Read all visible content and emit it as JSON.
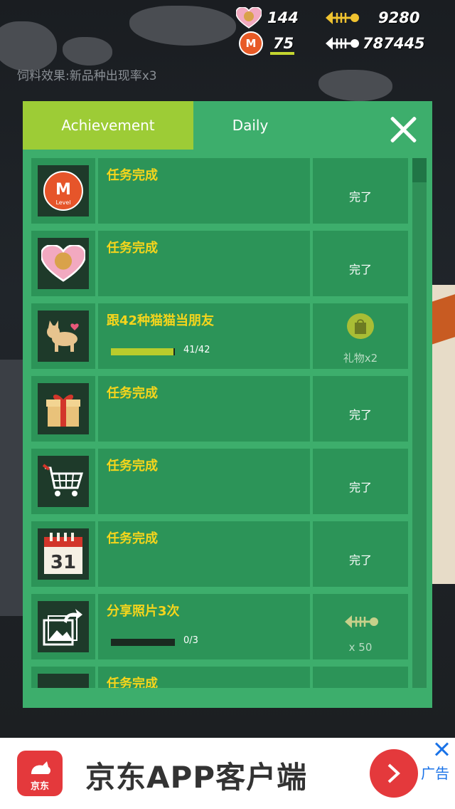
{
  "hud": {
    "hearts": "144",
    "fish_small": "9280",
    "level": "75",
    "fish_total": "787445",
    "feed_effect": "饲料效果:新品种出现率x3"
  },
  "dialog": {
    "tabs": [
      {
        "label": "Achievement",
        "active": true
      },
      {
        "label": "Daily",
        "active": false
      }
    ],
    "rows": [
      {
        "icon": "level-badge-icon",
        "title": "任务完成",
        "status": "完了"
      },
      {
        "icon": "cat-heart-icon",
        "title": "任务完成",
        "status": "完了"
      },
      {
        "icon": "cat-friend-icon",
        "title": "跟42种猫猫当朋友",
        "progress_text": "41/42",
        "progress": 0.976,
        "reward": "礼物x2",
        "reward_icon": "gift-bag-icon"
      },
      {
        "icon": "gift-box-icon",
        "title": "任务完成",
        "status": "完了"
      },
      {
        "icon": "shopping-cart-icon",
        "title": "任务完成",
        "status": "完了"
      },
      {
        "icon": "calendar-icon",
        "title": "任务完成",
        "status": "完了",
        "calendar_day": "31"
      },
      {
        "icon": "share-photo-icon",
        "title": "分享照片3次",
        "progress_text": "0/3",
        "progress": 0,
        "reward": "x 50",
        "reward_icon": "fish-bone-icon"
      },
      {
        "icon": "unknown-icon",
        "title": "任务完成"
      }
    ]
  },
  "ad": {
    "brand": "京东",
    "text": "京东APP客户端",
    "tag": "广告"
  },
  "colors": {
    "dialog_green": "#3dae6c",
    "tab_active": "#9dcc36",
    "title_yellow": "#f5d51c",
    "ad_red": "#e4393c"
  }
}
